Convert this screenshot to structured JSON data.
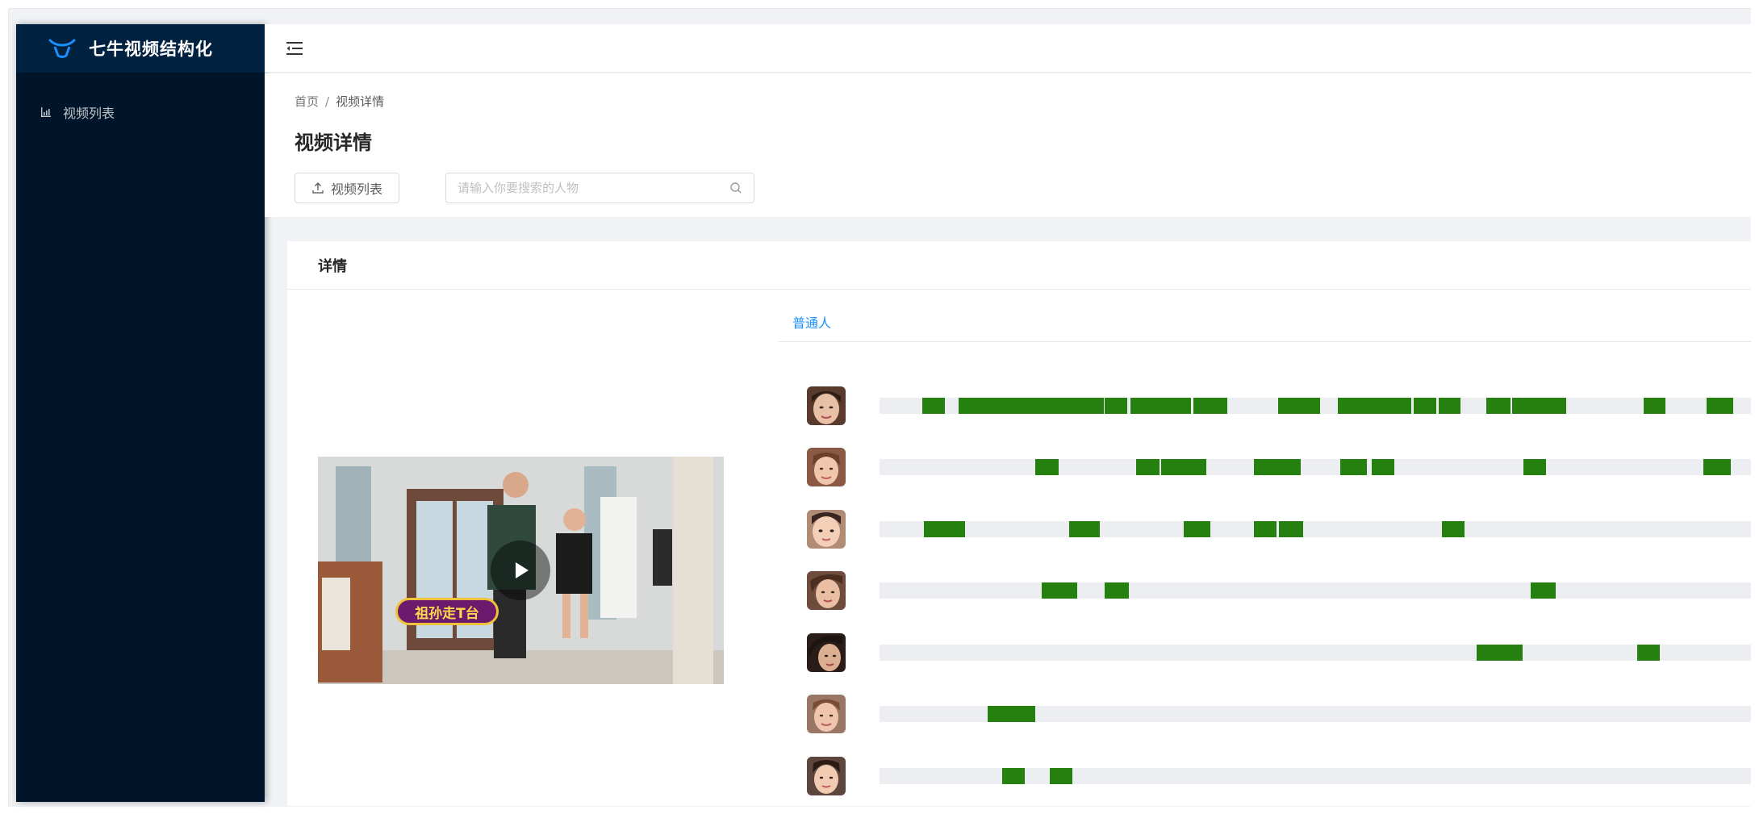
{
  "app": {
    "title": "七牛视频结构化"
  },
  "sidebar": {
    "items": [
      {
        "label": "视频列表",
        "icon": "bar-chart-icon"
      }
    ]
  },
  "header": {
    "toggle_icon": "menu-fold-icon"
  },
  "breadcrumb": {
    "home": "首页",
    "separator": "/",
    "current": "视频详情"
  },
  "page": {
    "title": "视频详情",
    "list_button_label": "视频列表",
    "search_placeholder": "请输入你要搜索的人物"
  },
  "card": {
    "title": "详情"
  },
  "video": {
    "badge_text": "祖孙走T台"
  },
  "tabs": [
    {
      "label": "普通人",
      "active": true
    }
  ],
  "colors": {
    "sidebar_bg": "#001529",
    "logo_bg": "#002140",
    "accent": "#1890ff",
    "segment": "#26800f",
    "track": "#eceef1"
  },
  "timeline": {
    "rows": [
      {
        "face": "face-1",
        "segments": [
          [
            0.049,
            0.075
          ],
          [
            0.091,
            0.257
          ],
          [
            0.258,
            0.284
          ],
          [
            0.288,
            0.357
          ],
          [
            0.36,
            0.399
          ],
          [
            0.457,
            0.506
          ],
          [
            0.526,
            0.61
          ],
          [
            0.613,
            0.639
          ],
          [
            0.642,
            0.667
          ],
          [
            0.696,
            0.724
          ],
          [
            0.726,
            0.788
          ],
          [
            0.877,
            0.902
          ],
          [
            0.949,
            0.98
          ]
        ]
      },
      {
        "face": "face-2",
        "segments": [
          [
            0.179,
            0.206
          ],
          [
            0.294,
            0.321
          ],
          [
            0.323,
            0.375
          ],
          [
            0.43,
            0.483
          ],
          [
            0.529,
            0.559
          ],
          [
            0.565,
            0.591
          ],
          [
            0.739,
            0.765
          ],
          [
            0.945,
            0.977
          ]
        ]
      },
      {
        "face": "face-3",
        "segments": [
          [
            0.051,
            0.098
          ],
          [
            0.218,
            0.253
          ],
          [
            0.349,
            0.38
          ],
          [
            0.43,
            0.456
          ],
          [
            0.458,
            0.486
          ],
          [
            0.645,
            0.671
          ]
        ]
      },
      {
        "face": "face-4",
        "segments": [
          [
            0.186,
            0.227
          ],
          [
            0.258,
            0.286
          ],
          [
            0.747,
            0.776
          ]
        ]
      },
      {
        "face": "face-5",
        "segments": [
          [
            0.685,
            0.738
          ],
          [
            0.869,
            0.895
          ]
        ]
      },
      {
        "face": "face-6",
        "segments": [
          [
            0.124,
            0.179
          ]
        ]
      },
      {
        "face": "face-7",
        "segments": [
          [
            0.141,
            0.167
          ],
          [
            0.195,
            0.221
          ]
        ]
      }
    ]
  }
}
